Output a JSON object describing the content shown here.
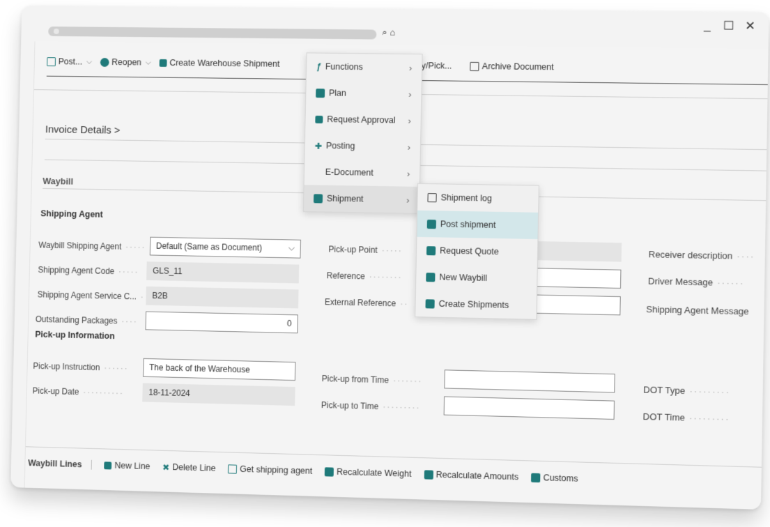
{
  "window": {
    "minimize": "_",
    "maximize": "☐",
    "close": "✕"
  },
  "toolbar": {
    "post": "Post...",
    "reopen": "Reopen",
    "create_warehouse_shipment": "Create Warehouse Shipment",
    "putaway_pick": "away/Pick...",
    "archive_document": "Archive Document"
  },
  "sections": {
    "invoice_details": "Invoice Details",
    "invoice_details_chevron": ">",
    "waybill": "Waybill",
    "shipping_agent": "Shipping Agent",
    "pickup_information": "Pick-up Information"
  },
  "fields": {
    "waybill_shipping_agent": {
      "label": "Waybill Shipping Agent",
      "value": "Default (Same as Document)"
    },
    "shipping_agent_code": {
      "label": "Shipping Agent Code",
      "value": "GLS_11"
    },
    "shipping_agent_service": {
      "label": "Shipping Agent Service C...",
      "value": "B2B"
    },
    "outstanding_packages": {
      "label": "Outstanding Packages",
      "value": "0"
    },
    "pickup_point": {
      "label": "Pick-up Point",
      "value": ""
    },
    "reference": {
      "label": "Reference",
      "value": ""
    },
    "external_reference": {
      "label": "External Reference",
      "value": ""
    },
    "receiver_description": {
      "label": "Receiver description"
    },
    "driver_message": {
      "label": "Driver Message"
    },
    "shipping_agent_message": {
      "label": "Shipping Agent Message"
    },
    "pickup_instruction": {
      "label": "Pick-up Instruction",
      "value": "The back of the Warehouse"
    },
    "pickup_date": {
      "label": "Pick-up Date",
      "value": "18-11-2024"
    },
    "pickup_from_time": {
      "label": "Pick-up from Time",
      "value": ""
    },
    "pickup_to_time": {
      "label": "Pick-up to Time",
      "value": ""
    },
    "dot_type": {
      "label": "DOT Type"
    },
    "dot_time": {
      "label": "DOT Time"
    }
  },
  "menu": {
    "items": [
      {
        "label": "Functions"
      },
      {
        "label": "Plan"
      },
      {
        "label": "Request Approval"
      },
      {
        "label": "Posting"
      },
      {
        "label": "E-Document"
      },
      {
        "label": "Shipment"
      }
    ]
  },
  "submenu": {
    "items": [
      {
        "label": "Shipment log"
      },
      {
        "label": "Post shipment"
      },
      {
        "label": "Request Quote"
      },
      {
        "label": "New Waybill"
      },
      {
        "label": "Create Shipments"
      }
    ]
  },
  "bottom_bar": {
    "title": "Waybill Lines",
    "new_line": "New Line",
    "delete_line": "Delete Line",
    "get_shipping_agent": "Get shipping agent",
    "recalculate_weight": "Recalculate Weight",
    "recalculate_amounts": "Recalculate Amounts",
    "customs": "Customs"
  },
  "colors": {
    "accent": "#1f7a7a",
    "hover": "#d3e7ea"
  }
}
